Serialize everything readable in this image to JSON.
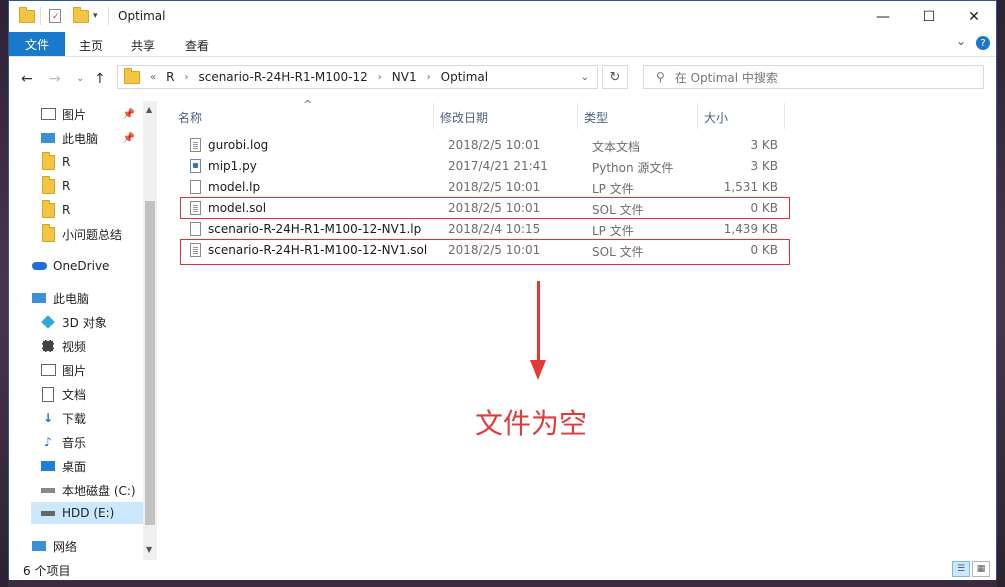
{
  "window": {
    "title": "Optimal"
  },
  "titlebar": {
    "minimize": "—",
    "maximize": "☐",
    "close": "✕"
  },
  "ribbon": {
    "file_tab": "文件",
    "tabs": [
      "主页",
      "共享",
      "查看"
    ],
    "expand": "⌄",
    "help": "?"
  },
  "nav": {
    "back": "←",
    "forward": "→",
    "recent": "⌄",
    "up": "↑",
    "breadcrumb": [
      "«",
      "R",
      "scenario-R-24H-R1-M100-12",
      "NV1",
      "Optimal"
    ],
    "refresh": "↻",
    "search_placeholder": "在 Optimal 中搜索"
  },
  "sidebar": {
    "items": [
      {
        "label": "图片",
        "icon": "pictures-icon",
        "pinned": true
      },
      {
        "label": "此电脑",
        "icon": "computer-icon",
        "pinned": true
      },
      {
        "label": "R",
        "icon": "folder-icon"
      },
      {
        "label": "R",
        "icon": "folder-icon"
      },
      {
        "label": "R",
        "icon": "folder-icon"
      },
      {
        "label": "小问题总结",
        "icon": "folder-icon"
      },
      {
        "label": "OneDrive",
        "icon": "cloud-icon"
      },
      {
        "label": "此电脑",
        "icon": "computer-icon"
      },
      {
        "label": "3D 对象",
        "icon": "3d-objects-icon"
      },
      {
        "label": "视频",
        "icon": "video-icon"
      },
      {
        "label": "图片",
        "icon": "pictures-icon"
      },
      {
        "label": "文档",
        "icon": "documents-icon"
      },
      {
        "label": "下载",
        "icon": "download-icon"
      },
      {
        "label": "音乐",
        "icon": "music-icon"
      },
      {
        "label": "桌面",
        "icon": "desktop-icon"
      },
      {
        "label": "本地磁盘 (C:)",
        "icon": "drive-icon"
      },
      {
        "label": "HDD (E:)",
        "icon": "drive-icon",
        "selected": true
      },
      {
        "label": "网络",
        "icon": "network-icon"
      }
    ]
  },
  "columns": {
    "name": "名称",
    "date": "修改日期",
    "type": "类型",
    "size": "大小",
    "sort_indicator": "^"
  },
  "files": [
    {
      "name": "gurobi.log",
      "date": "2018/2/5 10:01",
      "type": "文本文档",
      "size": "3 KB",
      "icon": "text-file-icon"
    },
    {
      "name": "mip1.py",
      "date": "2017/4/21 21:41",
      "type": "Python 源文件",
      "size": "3 KB",
      "icon": "python-file-icon"
    },
    {
      "name": "model.lp",
      "date": "2018/2/5 10:01",
      "type": "LP 文件",
      "size": "1,531 KB",
      "icon": "file-icon"
    },
    {
      "name": "model.sol",
      "date": "2018/2/5 10:01",
      "type": "SOL 文件",
      "size": "0 KB",
      "icon": "text-file-icon",
      "highlighted": true
    },
    {
      "name": "scenario-R-24H-R1-M100-12-NV1.lp",
      "date": "2018/2/4 10:15",
      "type": "LP 文件",
      "size": "1,439 KB",
      "icon": "file-icon"
    },
    {
      "name": "scenario-R-24H-R1-M100-12-NV1.sol",
      "date": "2018/2/5 10:01",
      "type": "SOL 文件",
      "size": "0 KB",
      "icon": "text-file-icon",
      "highlighted": true
    }
  ],
  "annotation": {
    "text": "文件为空",
    "color": "#e03a3a"
  },
  "status": {
    "count": "6 个项目"
  },
  "colors": {
    "accent": "#1979ca",
    "highlight": "#e0303a",
    "header_text": "#4d6082"
  }
}
